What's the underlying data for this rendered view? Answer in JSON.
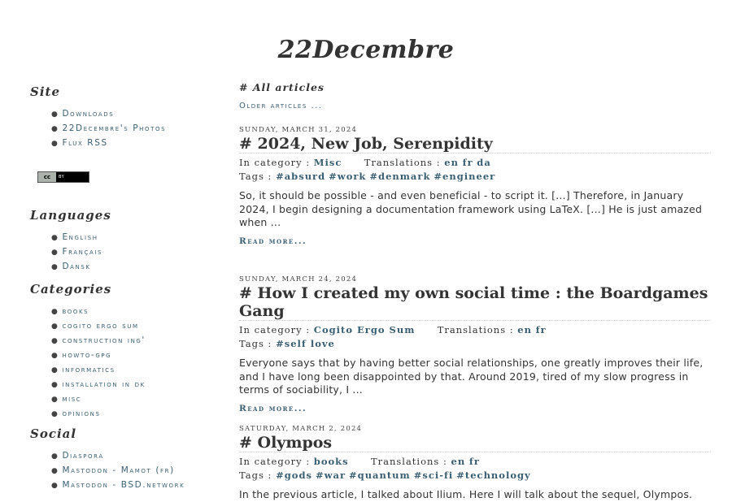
{
  "site_title": "22Decembre",
  "sidebar": {
    "site": {
      "heading": "Site",
      "items": [
        "Downloads",
        "22Decembre's Photos",
        "Flux RSS"
      ]
    },
    "license_badge": {
      "left": "cc",
      "right": "BY"
    },
    "languages": {
      "heading": "Languages",
      "items": [
        "English",
        "Français",
        "Dansk"
      ]
    },
    "categories": {
      "heading": "Categories",
      "items": [
        "books",
        "cogito ergo sum",
        "construction ing'",
        "howto-gpg",
        "informatics",
        "installation in dk",
        "misc",
        "opinions"
      ]
    },
    "social": {
      "heading": "Social",
      "items": [
        "Diaspora",
        "Mastodon - Mamot (fr)",
        "Mastodon - BSD.network"
      ]
    }
  },
  "main": {
    "heading": "# All articles",
    "older_link": "Older articles ...",
    "labels": {
      "category": "In category :",
      "translations": "Translations :",
      "tags": "Tags :",
      "read_more": "Read more..."
    },
    "articles": [
      {
        "date": "Sunday, March 31, 2024",
        "title": "# 2024, New Job, Serenpidity",
        "category": "Misc",
        "translations": [
          "en",
          "fr",
          "da"
        ],
        "tags": [
          "#absurd",
          "#work",
          "#denmark",
          "#engineer"
        ],
        "summary": "So, it should be possible - and even beneficial - to script it. [...] Therefore, in January 2024, I begin designing a documentation framework using LaTeX. [...] He is just amazed when ..."
      },
      {
        "date": "Sunday, March 24, 2024",
        "title": "# How I created my own social time : the Boardgames Gang",
        "category": "Cogito Ergo Sum",
        "translations": [
          "en",
          "fr"
        ],
        "tags": [
          "#self love"
        ],
        "summary": "Everyone says that by having better social relationships, one greatly improves their life, and I have long been disappointed by that. Around 2019, tired of my slow progress in terms of sociability, I ..."
      },
      {
        "date": "Saturday, March 2, 2024",
        "title": "# Olympos",
        "category": "books",
        "translations": [
          "en",
          "fr"
        ],
        "tags": [
          "#gods",
          "#war",
          "#quantum",
          "#sci-fi",
          "#technology"
        ],
        "summary": "In the previous article, I talked about Ilium. Here I will talk about the sequel, Olympos."
      }
    ]
  }
}
